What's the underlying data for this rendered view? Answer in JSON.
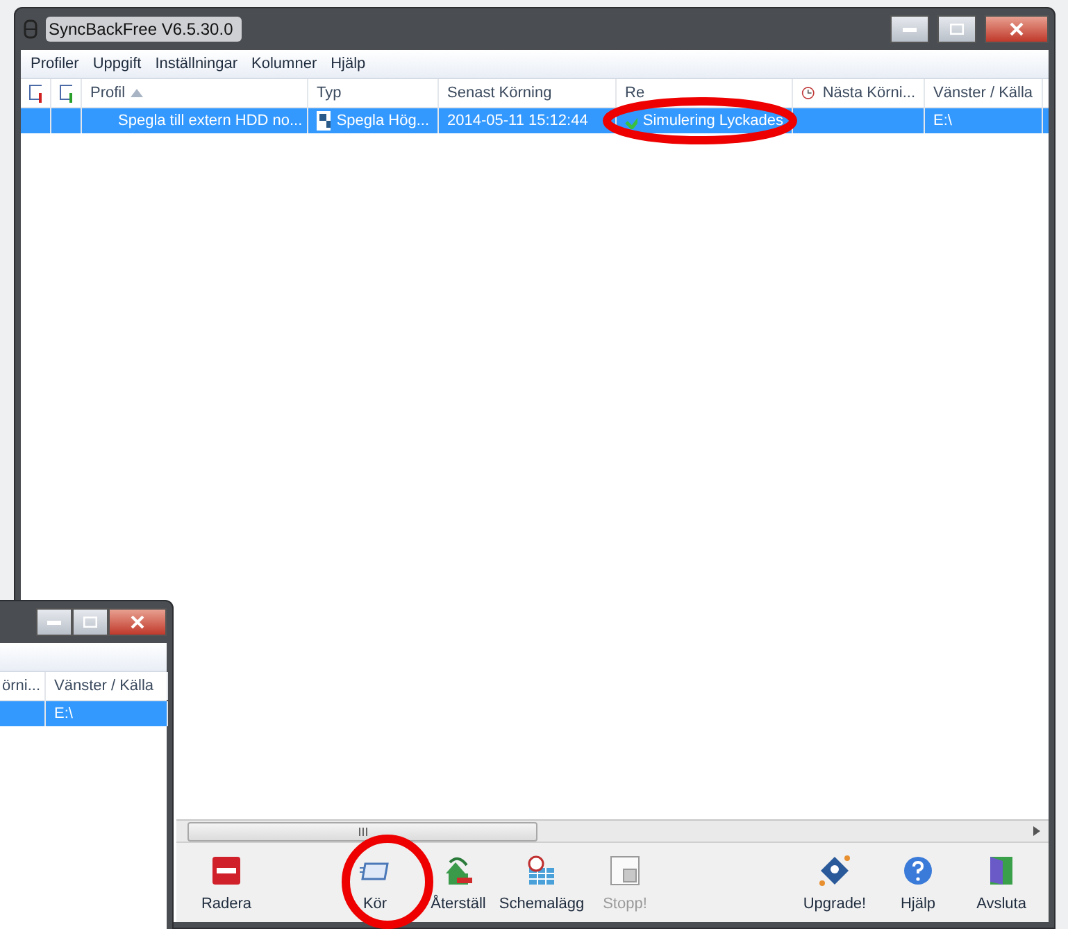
{
  "main_window": {
    "title": "SyncBackFree V6.5.30.0",
    "menu": [
      "Profiler",
      "Uppgift",
      "Inställningar",
      "Kolumner",
      "Hjälp"
    ],
    "columns": [
      {
        "label": "Profil",
        "kind": "sorted"
      },
      {
        "label": "Typ",
        "kind": "plain"
      },
      {
        "label": "Senast Körning",
        "kind": "plain"
      },
      {
        "label": "Re",
        "kind": "plain"
      },
      {
        "label": "Nästa Körni...",
        "kind": "clock"
      },
      {
        "label": "Vänster / Källa",
        "kind": "plain"
      }
    ],
    "rows": [
      {
        "selected": true,
        "profile": "Spegla till extern HDD no...",
        "type": "Spegla Hög...",
        "last_run": "2014-05-11 15:12:44",
        "result": "Simulering Lyckades",
        "source": "E:\\"
      }
    ],
    "toolbar": [
      {
        "label": "Radera",
        "kind": "delete",
        "disabled": false
      },
      {
        "label": "Kör",
        "kind": "run",
        "disabled": false
      },
      {
        "label": "Återställ",
        "kind": "restore",
        "disabled": false
      },
      {
        "label": "Schemalägg",
        "kind": "schedule",
        "disabled": false
      },
      {
        "label": "Stopp!",
        "kind": "stop",
        "disabled": true
      },
      {
        "label": "Upgrade!",
        "kind": "upgrade",
        "disabled": false
      },
      {
        "label": "Hjälp",
        "kind": "help",
        "disabled": false
      },
      {
        "label": "Avsluta",
        "kind": "exit",
        "disabled": false
      }
    ]
  },
  "back_window": {
    "columns": [
      "örni...",
      "Vänster / Källa"
    ],
    "rows": [
      {
        "selected": true,
        "source": "E:\\"
      }
    ]
  }
}
